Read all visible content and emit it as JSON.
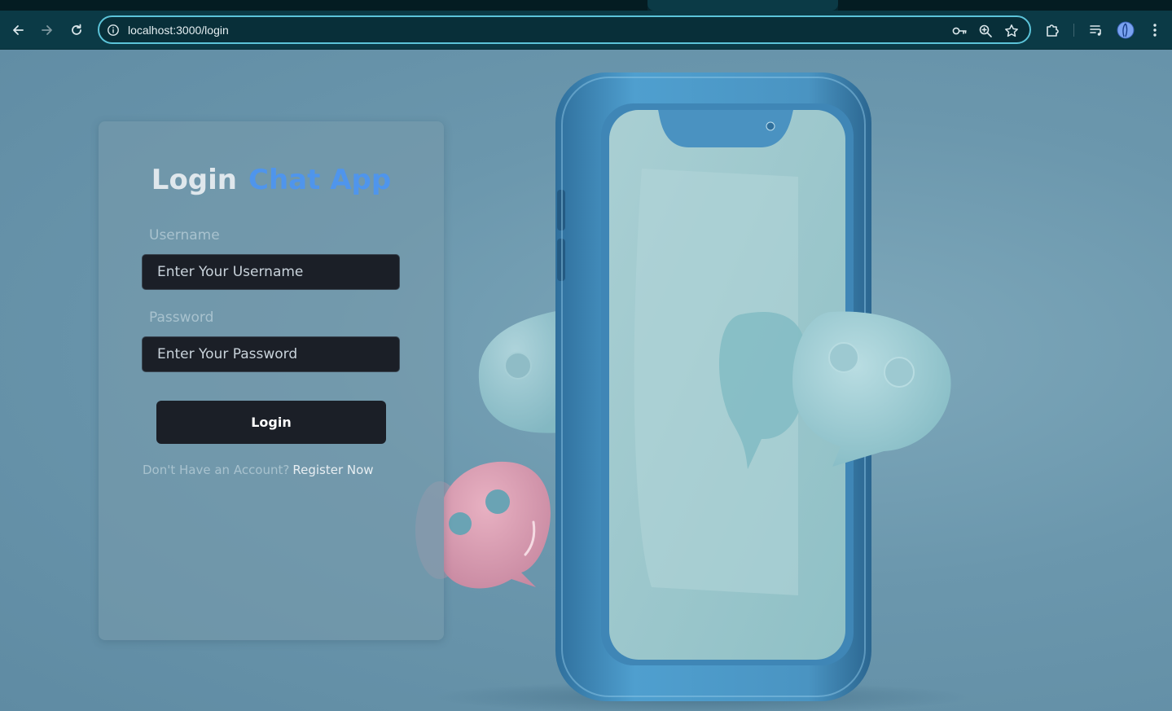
{
  "browser": {
    "url": "localhost:3000/login"
  },
  "login_card": {
    "title_prefix": "Login",
    "title_accent": "Chat App",
    "username": {
      "label": "Username",
      "placeholder": "Enter Your Username",
      "value": ""
    },
    "password": {
      "label": "Password",
      "placeholder": "Enter Your Password",
      "value": ""
    },
    "submit_label": "Login",
    "register_prompt": "Don't Have an Account?",
    "register_link": "Register Now"
  },
  "colors": {
    "accent": "#4f95ec",
    "omnibox_focus": "#5cc4d9",
    "button_bg": "#1b1f27"
  }
}
